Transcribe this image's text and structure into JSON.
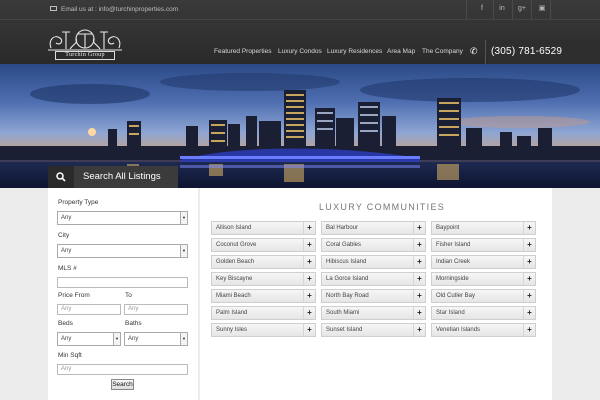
{
  "header": {
    "email": "Email us at : info@turchinproperties.com",
    "logo_text": "Turchin Group",
    "phone": "(305) 781-6529",
    "social": [
      {
        "icon": "facebook-icon",
        "glyph": "f"
      },
      {
        "icon": "linkedin-icon",
        "glyph": "in"
      },
      {
        "icon": "google-plus-icon",
        "glyph": "g+"
      },
      {
        "icon": "blog-icon",
        "glyph": "▣"
      }
    ],
    "nav": [
      "Featured Properties",
      "Luxury Condos",
      "Luxury Residences",
      "Area Map",
      "The Company"
    ]
  },
  "search": {
    "tab_label": "Search All Listings",
    "property_type_label": "Property Type",
    "property_type_value": "Any",
    "city_label": "City",
    "city_value": "Any",
    "mls_label": "MLS #",
    "price_from_label": "Price From",
    "price_to_label": "To",
    "price_from_placeholder": "Any",
    "price_to_placeholder": "Any",
    "beds_label": "Beds",
    "beds_value": "Any",
    "baths_label": "Baths",
    "baths_value": "Any",
    "min_sqft_label": "Min Sqft",
    "min_sqft_placeholder": "Any",
    "button": "Search"
  },
  "communities": {
    "title": "LUXURY COMMUNITIES",
    "columns": [
      [
        "Allison Island",
        "Coconut Grove",
        "Golden Beach",
        "Key Biscayne",
        "Miami Beach",
        "Palm Island",
        "Sunny Isles"
      ],
      [
        "Bal Harbour",
        "Coral Gables",
        "Hibiscus Island",
        "La Gorce Island",
        "North Bay Road",
        "South Miami",
        "Sunset Island"
      ],
      [
        "Baypoint",
        "Fisher Island",
        "Indian Creek",
        "Morningside",
        "Old Cutler Bay",
        "Star Island",
        "Venetian Islands"
      ]
    ]
  }
}
